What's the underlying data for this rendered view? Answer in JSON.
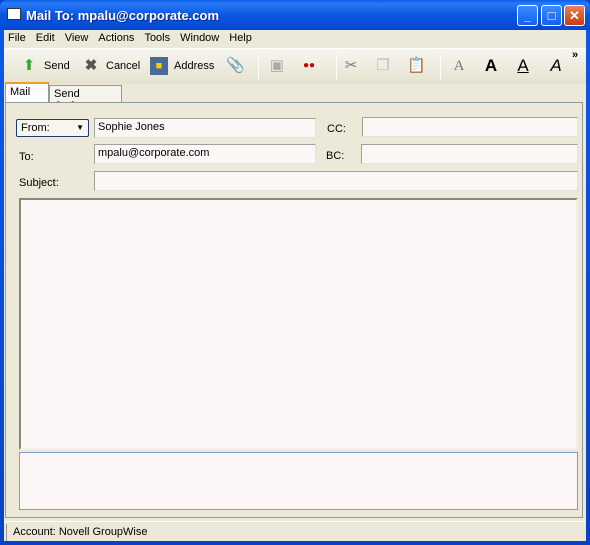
{
  "window": {
    "title": "Mail To: mpalu@corporate.com",
    "minimize": "_",
    "maximize": "□",
    "close": "✕"
  },
  "menu": [
    "File",
    "Edit",
    "View",
    "Actions",
    "Tools",
    "Window",
    "Help"
  ],
  "toolbar": {
    "send": "Send",
    "cancel": "Cancel",
    "address": "Address",
    "overflow": "»"
  },
  "tabs": [
    "Mail",
    "Send Options"
  ],
  "form": {
    "from_label": "From:",
    "from_value": "Sophie Jones",
    "to_label": "To:",
    "to_value": "mpalu@corporate.com",
    "cc_label": "CC:",
    "cc_value": "",
    "bc_label": "BC:",
    "bc_value": "",
    "subject_label": "Subject:",
    "subject_value": ""
  },
  "status": {
    "account": "Account: Novell GroupWise"
  }
}
